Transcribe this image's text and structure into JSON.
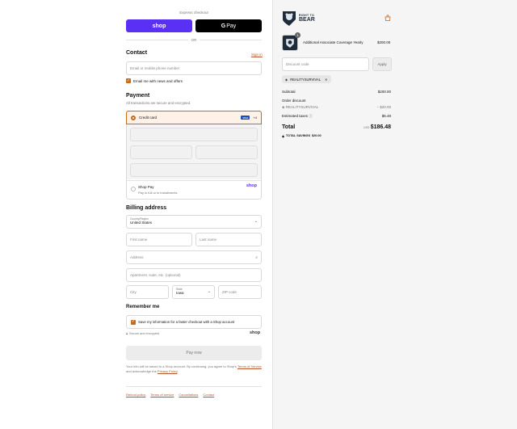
{
  "express": {
    "label": "Express checkout",
    "shop_pay": "shop",
    "gpay": "Pay",
    "or": "OR"
  },
  "contact": {
    "title": "Contact",
    "sign_in": "Sign in",
    "email_placeholder": "Email or mobile phone number",
    "news_label": "Email me with news and offers"
  },
  "payment": {
    "title": "Payment",
    "subtitle": "All transactions are secure and encrypted.",
    "credit_card": "Credit card",
    "card_badge": "VISA",
    "more_cards": "+4",
    "shop_pay_label": "Shop Pay",
    "shop_pay_sub": "Pay in full or in installments",
    "shop_pay_logo": "shop"
  },
  "billing": {
    "title": "Billing address",
    "country_label": "Country/Region",
    "country_value": "United States",
    "first_name": "First name",
    "last_name": "Last name",
    "address": "Address",
    "apartment": "Apartment, suite, etc. (optional)",
    "city": "City",
    "state_label": "State",
    "state_value": "Iowa",
    "zip": "ZIP code"
  },
  "remember": {
    "title": "Remember me",
    "save_label": "Save my information for a faster checkout with a Shop account",
    "secure": "Secure and encrypted",
    "shop_logo": "shop"
  },
  "pay_now": "Pay now",
  "disclaimer": {
    "pre": "Your info will be saved to a Shop account. By continuing, you agree to Shop's ",
    "terms": "Terms of Service",
    "mid": " and acknowledge the ",
    "privacy": "Privacy Policy",
    "post": "."
  },
  "footer_links": [
    "Refund policy",
    "Terms of service",
    "Cancellations",
    "Contact"
  ],
  "brand": {
    "line1": "RIGHT TO",
    "line2": "BEAR"
  },
  "order": {
    "item_name": "Additional Associate Coverage Yearly",
    "item_price": "$200.00",
    "item_qty": "1",
    "discount_placeholder": "Discount code",
    "apply": "Apply",
    "code_tag": "REALITYSURVIVAL",
    "subtotal_label": "Subtotal",
    "subtotal": "$200.00",
    "order_discount_label": "Order discount",
    "discount_code": "REALITYSURVIVAL",
    "discount_value": "− $20.00",
    "taxes_label": "Estimated taxes",
    "taxes": "$6.48",
    "total_label": "Total",
    "currency": "USD",
    "total": "$186.48",
    "savings_label": "TOTAL SAVINGS",
    "savings": "$20.00"
  },
  "colors": {
    "shop_purple": "#5a31f4",
    "accent_orange": "#c66a1d"
  }
}
